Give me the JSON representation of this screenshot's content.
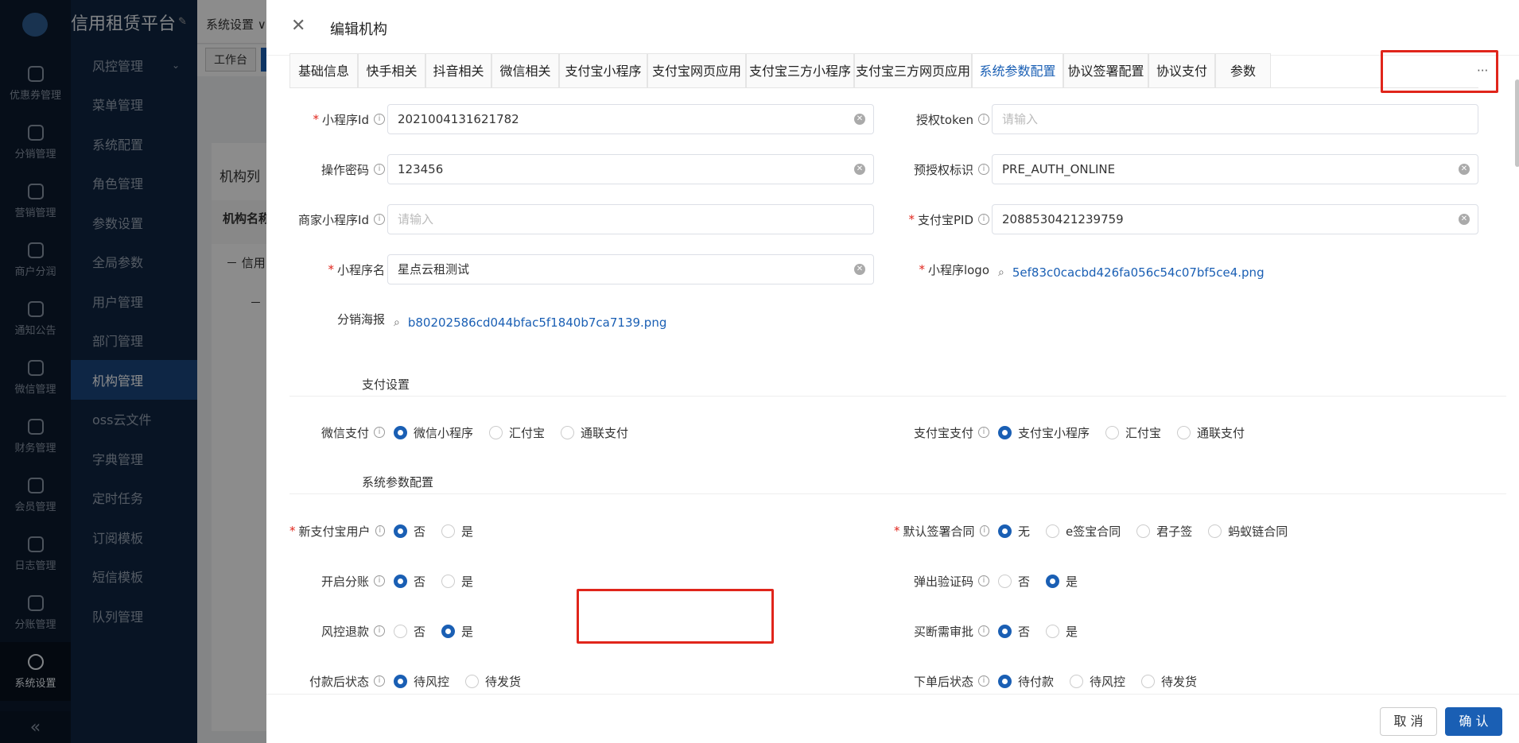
{
  "app": {
    "brand": "信用租赁平台"
  },
  "rail": {
    "items": [
      {
        "label": "优惠券管理",
        "icon": "gift-icon"
      },
      {
        "label": "分销管理",
        "icon": "sliders-icon"
      },
      {
        "label": "营销管理",
        "icon": "megaphone-icon"
      },
      {
        "label": "商户分润",
        "icon": "yen-icon"
      },
      {
        "label": "通知公告",
        "icon": "bell-icon"
      },
      {
        "label": "微信管理",
        "icon": "wechat-icon"
      },
      {
        "label": "财务管理",
        "icon": "finance-icon"
      },
      {
        "label": "会员管理",
        "icon": "user-icon"
      },
      {
        "label": "日志管理",
        "icon": "shield-icon"
      },
      {
        "label": "分账管理",
        "icon": "crown-icon"
      },
      {
        "label": "系统设置",
        "icon": "gear-icon"
      }
    ],
    "collapse": "«"
  },
  "menu": {
    "items": [
      "风控管理",
      "菜单管理",
      "系统配置",
      "角色管理",
      "参数设置",
      "全局参数",
      "用户管理",
      "部门管理",
      "机构管理",
      "oss云文件",
      "字典管理",
      "定时任务",
      "订阅模板",
      "短信模板",
      "队列管理"
    ],
    "active_index": 8
  },
  "background_page": {
    "breadcrumb": "系统设置 ∨",
    "tag": "工作台",
    "card_title": "机构列",
    "col_header": "机构名称",
    "row1": "－ 信用",
    "row2": "－"
  },
  "drawer": {
    "title": "编辑机构",
    "close": "✕",
    "tabs": [
      "基础信息",
      "快手相关",
      "抖音相关",
      "微信相关",
      "支付宝小程序",
      "支付宝网页应用",
      "支付宝三方小程序",
      "支付宝三方网页应用",
      "系统参数配置",
      "协议签署配置",
      "协议支付",
      "参数"
    ],
    "active_tab": 8,
    "tab_more": "···",
    "fields": {
      "mini_id": {
        "label": "小程序Id",
        "value": "2021004131621782"
      },
      "auth_token": {
        "label": "授权token",
        "placeholder": "请输入"
      },
      "op_password": {
        "label": "操作密码",
        "value": "123456"
      },
      "preauth": {
        "label": "预授权标识",
        "value": "PRE_AUTH_ONLINE"
      },
      "merchant_mini_id": {
        "label": "商家小程序Id",
        "placeholder": "请输入"
      },
      "alipay_pid": {
        "label": "支付宝PID",
        "value": "2088530421239759"
      },
      "mini_name": {
        "label": "小程序名",
        "value": "星点云租测试"
      },
      "mini_logo": {
        "label": "小程序logo",
        "file": "5ef83c0cacbd426fa056c54c07bf5ce4.png"
      },
      "poster": {
        "label": "分销海报",
        "file": "b80202586cd044bfac5f1840b7ca7139.png"
      }
    },
    "sections": {
      "pay": "支付设置",
      "sys": "系统参数配置"
    },
    "radios": {
      "wechat_pay": {
        "label": "微信支付",
        "options": [
          "微信小程序",
          "汇付宝",
          "通联支付"
        ],
        "selected": 0
      },
      "alipay_pay": {
        "label": "支付宝支付",
        "options": [
          "支付宝小程序",
          "汇付宝",
          "通联支付"
        ],
        "selected": 0
      },
      "new_alipay_user": {
        "label": "新支付宝用户",
        "options": [
          "否",
          "是"
        ],
        "selected": 0
      },
      "default_contract": {
        "label": "默认签署合同",
        "options": [
          "无",
          "e签宝合同",
          "君子签",
          "蚂蚁链合同"
        ],
        "selected": 0
      },
      "profit_share": {
        "label": "开启分账",
        "options": [
          "否",
          "是"
        ],
        "selected": 0
      },
      "popup_captcha": {
        "label": "弹出验证码",
        "options": [
          "否",
          "是"
        ],
        "selected": 1
      },
      "risk_refund": {
        "label": "风控退款",
        "options": [
          "否",
          "是"
        ],
        "selected": 1
      },
      "buyout_approval": {
        "label": "买断需审批",
        "options": [
          "否",
          "是"
        ],
        "selected": 0
      },
      "after_pay_status": {
        "label": "付款后状态",
        "options": [
          "待风控",
          "待发货"
        ],
        "selected": 0
      },
      "after_order_status": {
        "label": "下单后状态",
        "options": [
          "待付款",
          "待风控",
          "待发货"
        ],
        "selected": 0
      }
    },
    "footer": {
      "cancel": "取 消",
      "confirm": "确 认"
    }
  }
}
